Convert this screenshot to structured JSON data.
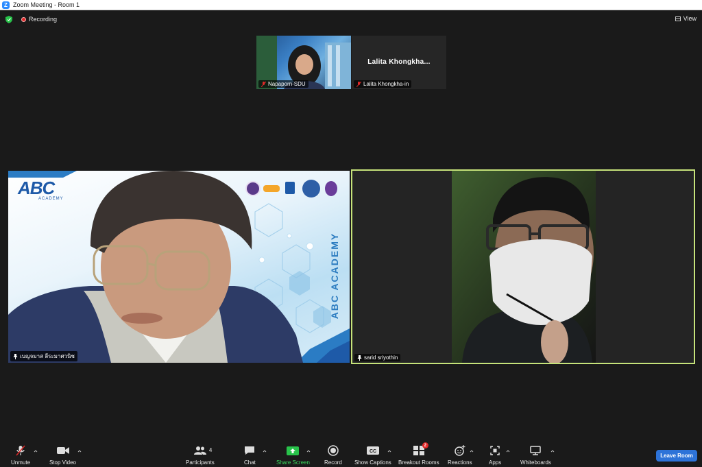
{
  "window": {
    "title": "Zoom Meeting - Room 1"
  },
  "topbar": {
    "recording_label": "Recording",
    "view_label": "View"
  },
  "thumbnails": [
    {
      "name": "Napaporn-SDU"
    },
    {
      "name": "Lalita Khongkha-in",
      "display_name": "Lalita  Khongkha..."
    }
  ],
  "tiles": [
    {
      "name": "เบญจมาส ลีระมาศวนิช",
      "brand_logo": "ABC",
      "brand_sub": "ACADEMY",
      "brand_vertical": "ABC ACADEMY"
    },
    {
      "name": "sarid sriyothin"
    }
  ],
  "toolbar": {
    "unmute": "Unmute",
    "stop_video": "Stop Video",
    "participants": "Participants",
    "participants_count": "4",
    "chat": "Chat",
    "share_screen": "Share Screen",
    "record": "Record",
    "show_captions": "Show Captions",
    "breakout_rooms": "Breakout Rooms",
    "breakout_badge": "2",
    "reactions": "Reactions",
    "apps": "Apps",
    "whiteboards": "Whiteboards",
    "leave": "Leave Room"
  },
  "colors": {
    "accent": "#2d73d8",
    "active_speaker": "#c6e37a",
    "share_green": "#28c24a",
    "record_red": "#e02828"
  }
}
